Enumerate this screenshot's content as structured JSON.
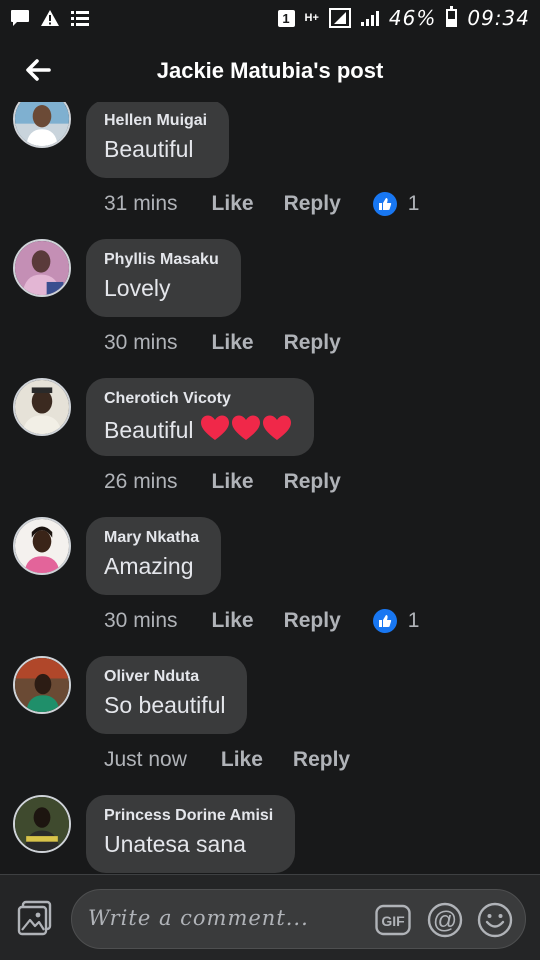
{
  "status_bar": {
    "notif_badge": "1",
    "network": "H+",
    "battery": "46%",
    "time": "09:34"
  },
  "header": {
    "title": "Jackie Matubia's post",
    "back_icon": "arrow-left-icon"
  },
  "comments": [
    {
      "name": "Hellen Muigai",
      "text": "Beautiful",
      "time": "31 mins",
      "like": "Like",
      "reply": "Reply",
      "likes": "1"
    },
    {
      "name": "Phyllis Masaku",
      "text": "Lovely",
      "time": "30 mins",
      "like": "Like",
      "reply": "Reply"
    },
    {
      "name": "Cherotich Vicoty",
      "text": "Beautiful",
      "hearts": 3,
      "time": "26 mins",
      "like": "Like",
      "reply": "Reply"
    },
    {
      "name": "Mary Nkatha",
      "text": "Amazing",
      "time": "30 mins",
      "like": "Like",
      "reply": "Reply",
      "likes": "1"
    },
    {
      "name": "Oliver Nduta",
      "text": "So beautiful",
      "time": "Just now",
      "like": "Like",
      "reply": "Reply"
    },
    {
      "name": "Princess Dorine Amisi",
      "text": "Unatesa sana"
    }
  ],
  "composer": {
    "placeholder": "Write a comment...",
    "gif_label": "GIF",
    "at_label": "@"
  },
  "colors": {
    "background": "#18191a",
    "bubble": "#3a3b3c",
    "like_blue": "#1877f2",
    "heart_red": "#f02849"
  }
}
